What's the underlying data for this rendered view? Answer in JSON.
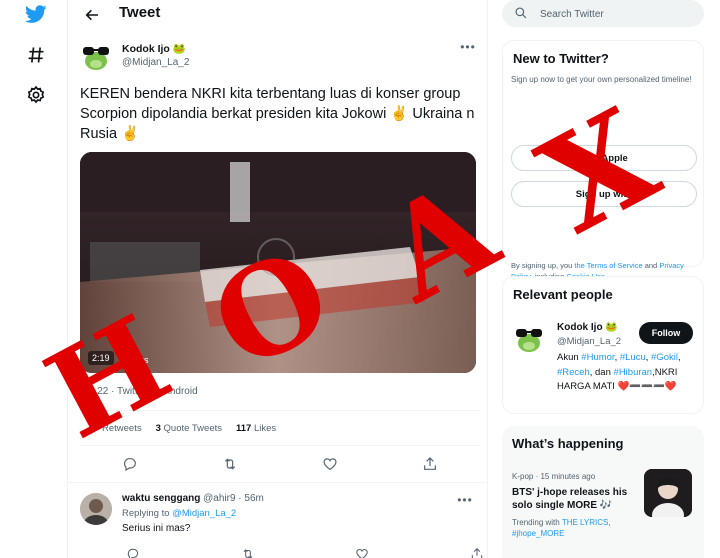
{
  "header": {
    "title": "Tweet"
  },
  "tweet": {
    "author_name": "Kodok Ijo 🐸",
    "author_handle": "@Midjan_La_2",
    "text": "KEREN bendera NKRI kita terbentang luas di konser group Scorpion dipolandia berkat presiden kita Jokowi ✌️ Ukraina n Rusia ✌️",
    "media_time": "2:19",
    "media_views": "views",
    "meta": "M · 22 · Twitter for Android",
    "stats": {
      "retweets_label": "Retweets",
      "quote_count": "3",
      "quote_label": "Quote Tweets",
      "likes_count": "117",
      "likes_label": "Likes"
    }
  },
  "reply": {
    "name": "waktu senggang",
    "handle": "@ahir9 · 56m",
    "replying_label": "Replying to",
    "replying_handle": "@Midjan_La_2",
    "text": "Serius  ini mas?"
  },
  "search": {
    "placeholder": "Search Twitter"
  },
  "new_to_twitter": {
    "title": "New to Twitter?",
    "subtitle": "Sign up now to get your own personalized timeline!",
    "apple_button": "with Apple",
    "signup_button": "Sign up with",
    "terms_prefix": "By signing up, you",
    "terms_link1": "the Terms of Service",
    "terms_mid": "and",
    "terms_link2": "Privacy Policy",
    "terms_suffix": ", including",
    "terms_link3": "Cookie Use."
  },
  "relevant_people": {
    "title": "Relevant people",
    "name": "Kodok Ijo 🐸",
    "handle": "@Midjan_La_2",
    "follow_label": "Follow",
    "bio_prefix": "Akun",
    "tag1": "#Humor",
    "tag2": "#Lucu",
    "tag3": "#Gokil",
    "tag4": "#Receh",
    "bio_dan": ", dan",
    "tag5": "#Hiburan",
    "bio_suffix": ",NKRI HARGA MATI",
    "hearts": "❤️➖➖➖❤️"
  },
  "happening": {
    "title": "What’s happening",
    "trend_meta": "K-pop · 15 minutes ago",
    "trend_title": "BTS' j-hope releases his solo single MORE 🎶",
    "trending_with_label": "Trending with",
    "trending_tag1": "THE LYRICS",
    "trending_tag2": "#jhope_MORE"
  },
  "overlay": {
    "letters": [
      "H",
      "O",
      "A",
      "X"
    ],
    "color": "#e00000"
  }
}
